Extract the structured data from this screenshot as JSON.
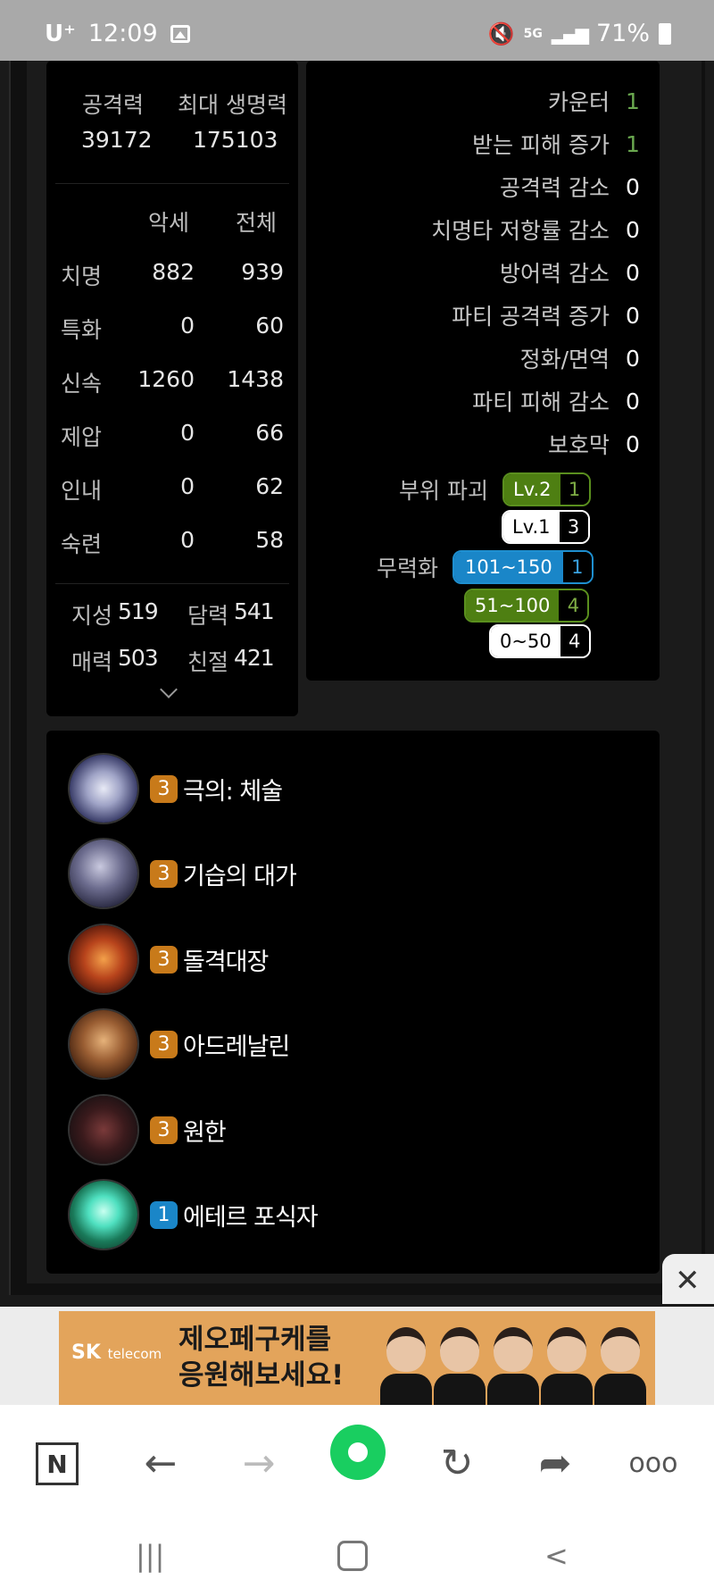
{
  "status_bar": {
    "carrier": "U⁺",
    "time": "12:09",
    "network": "5G",
    "battery": "71%"
  },
  "stats": {
    "attack_label": "공격력",
    "attack_value": "39172",
    "max_hp_label": "최대 생명력",
    "max_hp_value": "175103",
    "col_accessory": "악세",
    "col_total": "전체",
    "rows": [
      {
        "label": "치명",
        "accessory": "882",
        "total": "939"
      },
      {
        "label": "특화",
        "accessory": "0",
        "total": "60"
      },
      {
        "label": "신속",
        "accessory": "1260",
        "total": "1438"
      },
      {
        "label": "제압",
        "accessory": "0",
        "total": "66"
      },
      {
        "label": "인내",
        "accessory": "0",
        "total": "62"
      },
      {
        "label": "숙련",
        "accessory": "0",
        "total": "58"
      }
    ],
    "traits": [
      {
        "label": "지성",
        "value": "519"
      },
      {
        "label": "담력",
        "value": "541"
      },
      {
        "label": "매력",
        "value": "503"
      },
      {
        "label": "친절",
        "value": "421"
      }
    ]
  },
  "synergy": {
    "rows": [
      {
        "label": "카운터",
        "value": "1"
      },
      {
        "label": "받는 피해 증가",
        "value": "1"
      },
      {
        "label": "공격력 감소",
        "value": "0"
      },
      {
        "label": "치명타 저항률 감소",
        "value": "0"
      },
      {
        "label": "방어력 감소",
        "value": "0"
      },
      {
        "label": "파티 공격력 증가",
        "value": "0"
      },
      {
        "label": "정화/면역",
        "value": "0"
      },
      {
        "label": "파티 피해 감소",
        "value": "0"
      },
      {
        "label": "보호막",
        "value": "0"
      }
    ],
    "part_break_label": "부위 파괴",
    "part_break": [
      {
        "level": "Lv.2",
        "count": "1"
      },
      {
        "level": "Lv.1",
        "count": "3"
      }
    ],
    "stagger_label": "무력화",
    "stagger": [
      {
        "range": "101~150",
        "count": "1"
      },
      {
        "range": "51~100",
        "count": "4"
      },
      {
        "range": "0~50",
        "count": "4"
      }
    ]
  },
  "engravings": [
    {
      "level": "3",
      "name": "극의: 체술",
      "icon": "martial-fist-icon"
    },
    {
      "level": "3",
      "name": "기습의 대가",
      "icon": "ambush-master-icon"
    },
    {
      "level": "3",
      "name": "돌격대장",
      "icon": "vanguard-icon"
    },
    {
      "level": "3",
      "name": "아드레날린",
      "icon": "adrenaline-icon"
    },
    {
      "level": "3",
      "name": "원한",
      "icon": "grudge-icon"
    },
    {
      "level": "1",
      "name": "에테르 포식자",
      "icon": "ether-predator-icon"
    }
  ],
  "ad": {
    "brand": "SK",
    "brand_sub": "telecom",
    "line1": "제오페구케를",
    "line2": "응원해보세요!"
  },
  "browser_nav": {
    "logo": "N"
  }
}
